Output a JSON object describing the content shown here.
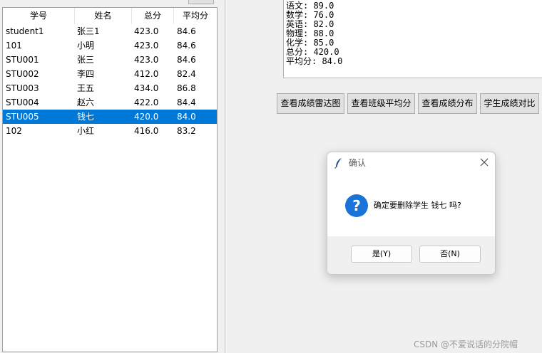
{
  "table": {
    "columns": [
      "学号",
      "姓名",
      "总分",
      "平均分"
    ],
    "rows": [
      {
        "id": "student1",
        "name": "张三1",
        "total": "423.0",
        "avg": "84.6"
      },
      {
        "id": "101",
        "name": "小明",
        "total": "423.0",
        "avg": "84.6"
      },
      {
        "id": "STU001",
        "name": "张三",
        "total": "423.0",
        "avg": "84.6"
      },
      {
        "id": "STU002",
        "name": "李四",
        "total": "412.0",
        "avg": "82.4"
      },
      {
        "id": "STU003",
        "name": "王五",
        "total": "434.0",
        "avg": "86.8"
      },
      {
        "id": "STU004",
        "name": "赵六",
        "total": "422.0",
        "avg": "84.4"
      },
      {
        "id": "STU005",
        "name": "钱七",
        "total": "420.0",
        "avg": "84.0"
      },
      {
        "id": "102",
        "name": "小红",
        "total": "416.0",
        "avg": "83.2"
      }
    ],
    "selected_row": "STU005"
  },
  "detail": {
    "lines": [
      "语文: 89.0",
      "数学: 76.0",
      "英语: 82.0",
      "物理: 88.0",
      "化学: 85.0",
      "总分: 420.0",
      "平均分: 84.0"
    ]
  },
  "buttons": {
    "radar": "查看成绩雷达图",
    "class_avg": "查看班级平均分",
    "distribution": "查看成绩分布",
    "compare": "学生成绩对比"
  },
  "dialog": {
    "title": "确认",
    "message": "确定要删除学生 钱七 吗?",
    "yes": "是(Y)",
    "no": "否(N)"
  },
  "watermark": "CSDN @不爱说话的分院帽",
  "colors": {
    "selection": "#0078d7",
    "question_icon": "#1a73d9"
  }
}
